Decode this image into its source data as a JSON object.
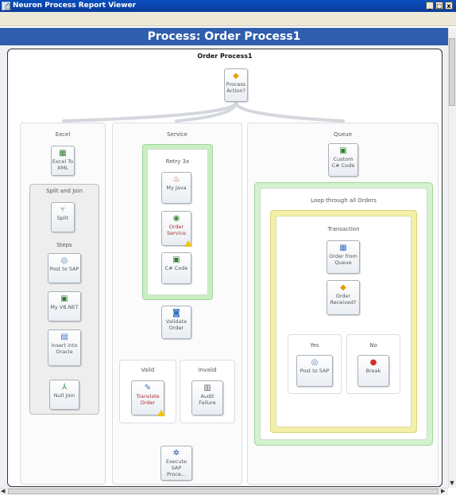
{
  "window": {
    "title": "Neuron Process Report Viewer",
    "minimize": "_",
    "maximize": "□",
    "close": "x"
  },
  "toolbar": {
    "print_icon": "print-icon"
  },
  "header": {
    "title": "Process: Order Process1"
  },
  "diagram": {
    "title": "Order Process1",
    "process_action": {
      "label": "Process Action?"
    },
    "branches": {
      "excel": {
        "label": "Excel",
        "excel_to_xml": "Excel To XML",
        "split_and_join": {
          "label": "Split and Join",
          "split": "Split",
          "steps": "Steps",
          "post_to_sap": "Post to SAP",
          "my_vbnet": "My VB.NET",
          "insert_into_oracle": "Insert into Oracle",
          "null_join": "Null Join"
        }
      },
      "service": {
        "label": "Service",
        "retry": {
          "label": "Retry 3x",
          "my_java": "My Java",
          "order_service": "Order Service",
          "csharp_code": "C# Code"
        },
        "validate_order": "Validate Order",
        "valid": {
          "label": "Valid",
          "translate_order": "Translate Order"
        },
        "invalid": {
          "label": "Invalid",
          "audit_failure": "Audit Failure"
        },
        "execute_sap": "Execute SAP Proce..."
      },
      "queue": {
        "label": "Queue",
        "custom_csharp": "Custom C# Code",
        "loop": {
          "label": "Loop through all Orders",
          "transaction": {
            "label": "Transaction",
            "order_from_queue": "Order from Queue",
            "order_received": "Order Received?",
            "yes": {
              "label": "Yes",
              "post_to_sap": "Post to SAP"
            },
            "no": {
              "label": "No",
              "break": "Break"
            }
          }
        }
      }
    }
  },
  "colors": {
    "title_bar": "#0a3a9a",
    "header": "#2e5ead",
    "retry_frame": "#c9efc1",
    "transaction_frame": "#f3f0a5",
    "error_text": "#b03030"
  }
}
